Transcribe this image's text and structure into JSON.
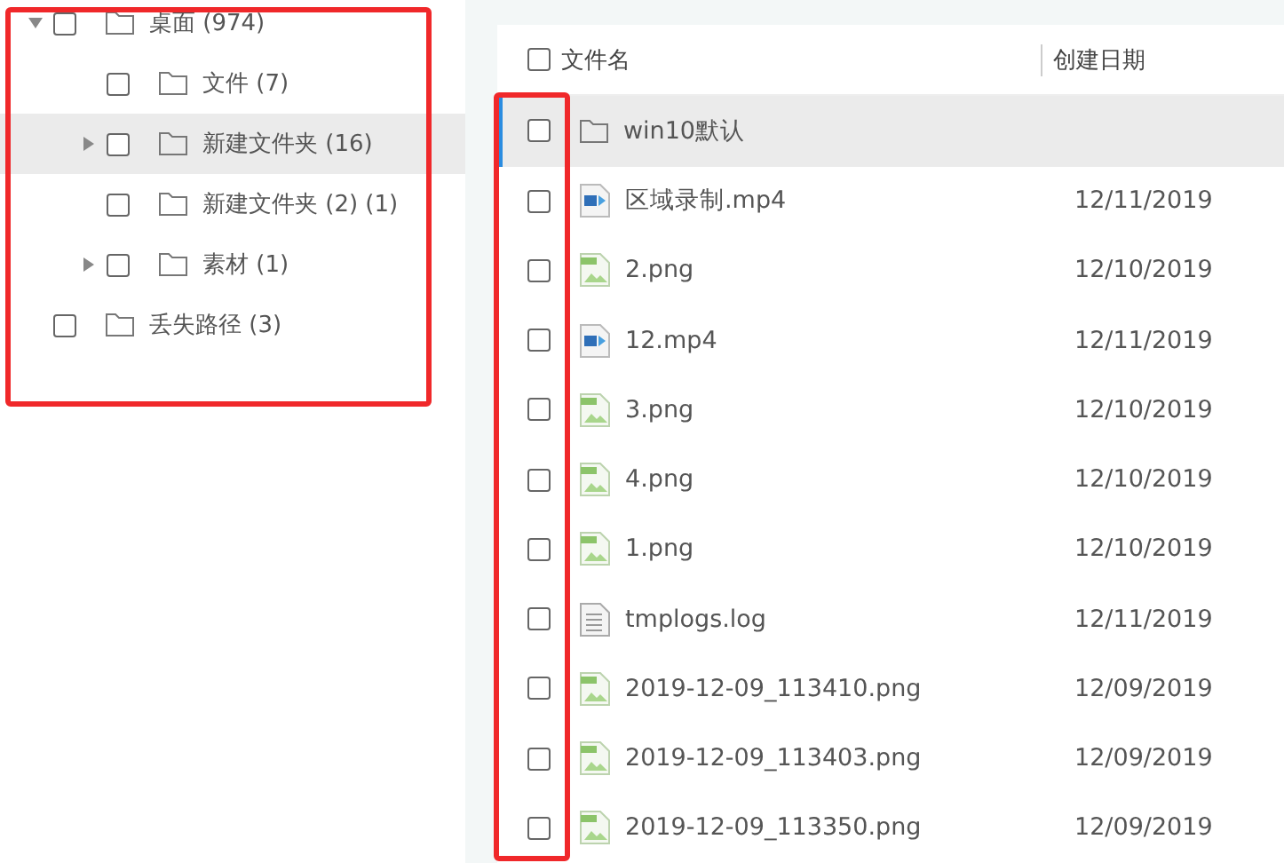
{
  "tree": [
    {
      "label": "桌面 (974)",
      "expanded": true,
      "selected": false,
      "checked": false,
      "children": [
        {
          "label": "文件 (7)",
          "selected": false,
          "checked": false
        },
        {
          "label": "新建文件夹 (16)",
          "expanded": false,
          "selected": true,
          "checked": false
        },
        {
          "label": "新建文件夹 (2) (1)",
          "selected": false,
          "checked": false
        },
        {
          "label": "素材 (1)",
          "expanded": false,
          "selected": false,
          "checked": false
        }
      ]
    },
    {
      "label": "丢失路径 (3)",
      "selected": false,
      "checked": false
    }
  ],
  "table": {
    "columns": [
      "文件名",
      "创建日期"
    ],
    "header_checked": false,
    "rows": [
      {
        "kind": "folder",
        "name": "win10默认",
        "date": "",
        "selected": true,
        "checked": false
      },
      {
        "kind": "video",
        "name": "区域录制.mp4",
        "date": "12/11/2019",
        "selected": false,
        "checked": false
      },
      {
        "kind": "image",
        "name": "2.png",
        "date": "12/10/2019",
        "selected": false,
        "checked": false
      },
      {
        "kind": "video",
        "name": "12.mp4",
        "date": "12/11/2019",
        "selected": false,
        "checked": false
      },
      {
        "kind": "image",
        "name": "3.png",
        "date": "12/10/2019",
        "selected": false,
        "checked": false
      },
      {
        "kind": "image",
        "name": "4.png",
        "date": "12/10/2019",
        "selected": false,
        "checked": false
      },
      {
        "kind": "image",
        "name": "1.png",
        "date": "12/10/2019",
        "selected": false,
        "checked": false
      },
      {
        "kind": "text",
        "name": "tmplogs.log",
        "date": "12/11/2019",
        "selected": false,
        "checked": false
      },
      {
        "kind": "image",
        "name": "2019-12-09_113410.png",
        "date": "12/09/2019",
        "selected": false,
        "checked": false
      },
      {
        "kind": "image",
        "name": "2019-12-09_113403.png",
        "date": "12/09/2019",
        "selected": false,
        "checked": false
      },
      {
        "kind": "image",
        "name": "2019-12-09_113350.png",
        "date": "12/09/2019",
        "selected": false,
        "checked": false
      }
    ]
  }
}
